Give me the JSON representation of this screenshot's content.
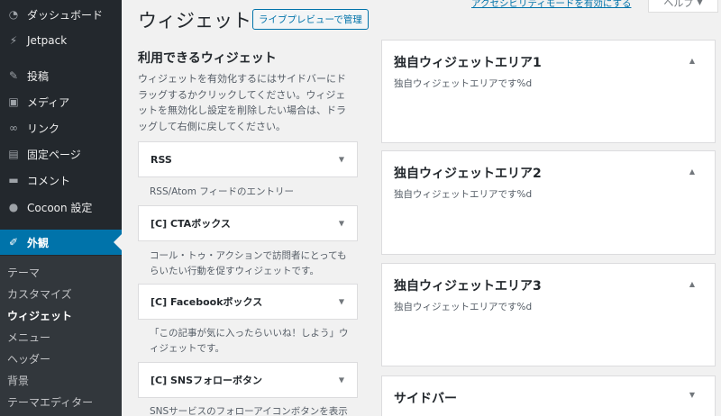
{
  "sidebar": {
    "items": [
      {
        "label": "ダッシュボード",
        "icon": "dashboard-icon"
      },
      {
        "label": "Jetpack",
        "icon": "jetpack-icon"
      },
      {
        "label": "投稿",
        "icon": "pin-icon"
      },
      {
        "label": "メディア",
        "icon": "media-icon"
      },
      {
        "label": "リンク",
        "icon": "link-icon"
      },
      {
        "label": "固定ページ",
        "icon": "page-icon"
      },
      {
        "label": "コメント",
        "icon": "comment-icon"
      },
      {
        "label": "Cocoon 設定",
        "icon": "circle-icon"
      },
      {
        "label": "外観",
        "icon": "appearance-icon"
      }
    ],
    "submenu": [
      "テーマ",
      "カスタマイズ",
      "ウィジェット",
      "メニュー",
      "ヘッダー",
      "背景",
      "テーマエディター"
    ],
    "accent_color": "#0073aa"
  },
  "header": {
    "title": "ウィジェット",
    "live_preview": "ライブプレビューで管理",
    "a11y_link": "アクセシビリティモードを有効にする",
    "help": "ヘルプ"
  },
  "available": {
    "title": "利用できるウィジェット",
    "description": "ウィジェットを有効化するにはサイドバーにドラッグするかクリックしてください。ウィジェットを無効化し設定を削除したい場合は、ドラッグして右側に戻してください。",
    "widgets": [
      {
        "name": "RSS",
        "description": "RSS/Atom フィードのエントリー"
      },
      {
        "name": "[C] CTAボックス",
        "description": "コール・トゥ・アクションで訪問者にとってもらいたい行動を促すウィジェットです。"
      },
      {
        "name": "[C] Facebookボックス",
        "description": "「この記事が気に入ったらいいね！しよう」ウィジェットです。"
      },
      {
        "name": "[C] SNSフォローボタン",
        "description": "SNSサービスのフォローアイコンボタンを表示"
      }
    ]
  },
  "areas": [
    {
      "title": "独自ウィジェットエリア1",
      "description": "独自ウィジェットエリアです%d"
    },
    {
      "title": "独自ウィジェットエリア2",
      "description": "独自ウィジェットエリアです%d"
    },
    {
      "title": "独自ウィジェットエリア3",
      "description": "独自ウィジェットエリアです%d"
    },
    {
      "title": "サイドバー",
      "description": ""
    }
  ]
}
